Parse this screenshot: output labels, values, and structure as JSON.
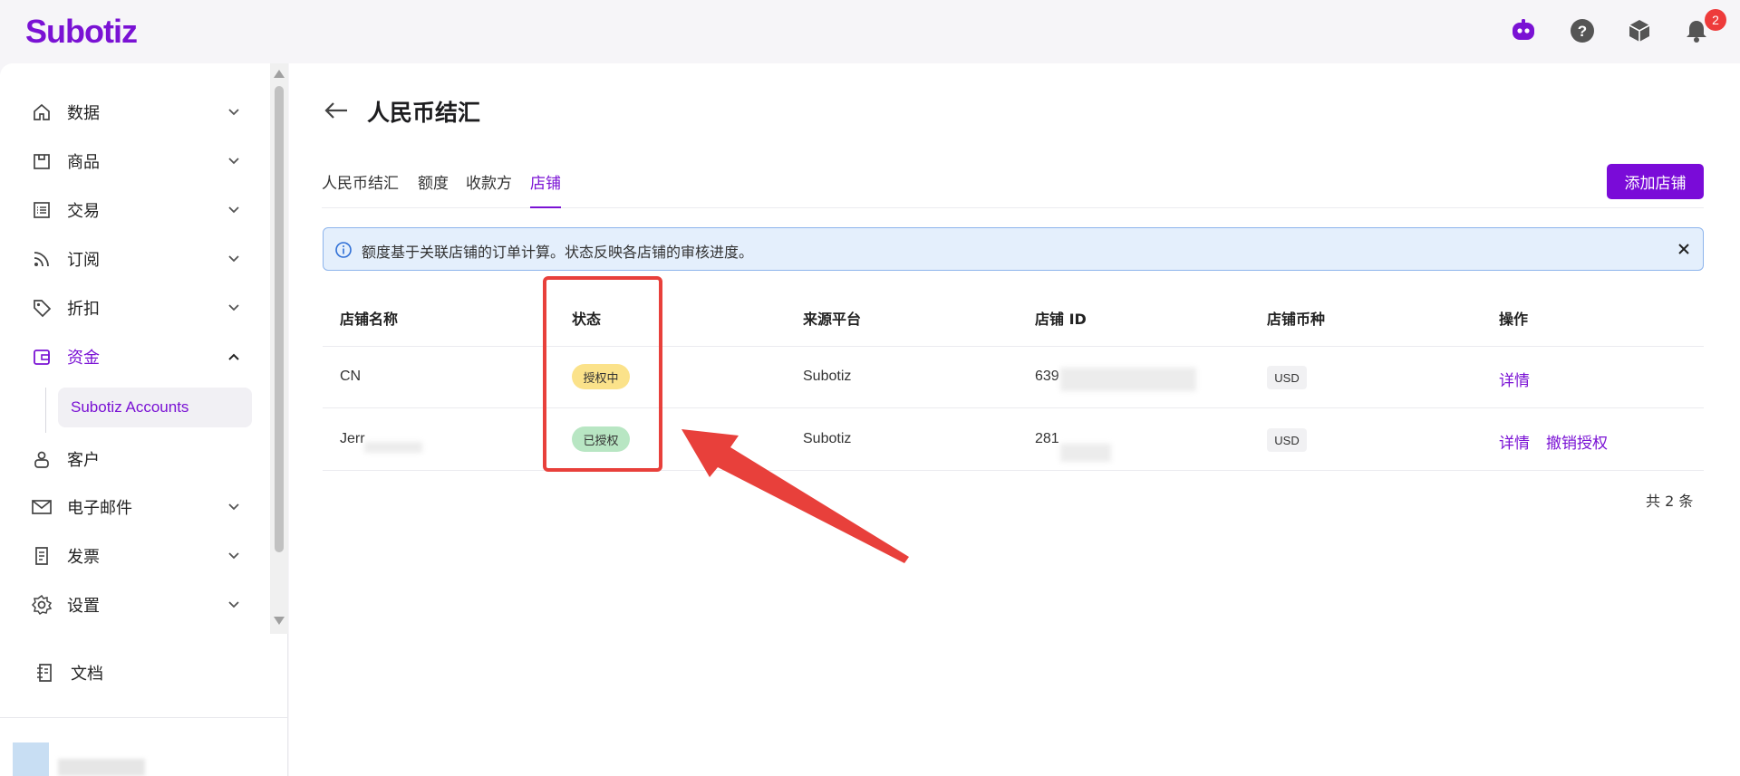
{
  "app": {
    "logo": "Subotiz",
    "notification_count": "2"
  },
  "topbar_icons": [
    "assistant-bot-icon",
    "help-icon",
    "package-icon",
    "bell-icon"
  ],
  "sidebar": {
    "items": [
      {
        "label": "数据",
        "icon": "home-icon"
      },
      {
        "label": "商品",
        "icon": "store-icon"
      },
      {
        "label": "交易",
        "icon": "list-icon"
      },
      {
        "label": "订阅",
        "icon": "rss-icon"
      },
      {
        "label": "折扣",
        "icon": "tag-icon"
      },
      {
        "label": "资金",
        "icon": "wallet-icon"
      },
      {
        "label": "客户",
        "icon": "user-icon"
      },
      {
        "label": "电子邮件",
        "icon": "mail-icon"
      },
      {
        "label": "发票",
        "icon": "invoice-icon"
      },
      {
        "label": "设置",
        "icon": "gear-icon"
      }
    ],
    "sub_item": "Subotiz Accounts",
    "docs": "文档"
  },
  "page": {
    "title": "人民币结汇",
    "tabs": [
      "人民币结汇",
      "额度",
      "收款方",
      "店铺"
    ],
    "active_tab": "店铺",
    "add_button": "添加店铺",
    "alert": "额度基于关联店铺的订单计算。状态反映各店铺的审核进度。"
  },
  "table": {
    "headers": [
      "店铺名称",
      "状态",
      "来源平台",
      "店铺 ID",
      "店铺币种",
      "操作"
    ],
    "rows": [
      {
        "name": "CN",
        "status": "授权中",
        "platform": "Subotiz",
        "store_id": "639",
        "currency": "USD",
        "actions": [
          "详情"
        ]
      },
      {
        "name": "Jerr",
        "status": "已授权",
        "platform": "Subotiz",
        "store_id": "281",
        "currency": "USD",
        "actions": [
          "详情",
          "撤销授权"
        ]
      }
    ],
    "total": "共 2 条"
  },
  "colors": {
    "brand": "#7a12d4",
    "pending": "#fbe28a",
    "authorized": "#b8e6c3",
    "annotation": "#e8403b"
  }
}
